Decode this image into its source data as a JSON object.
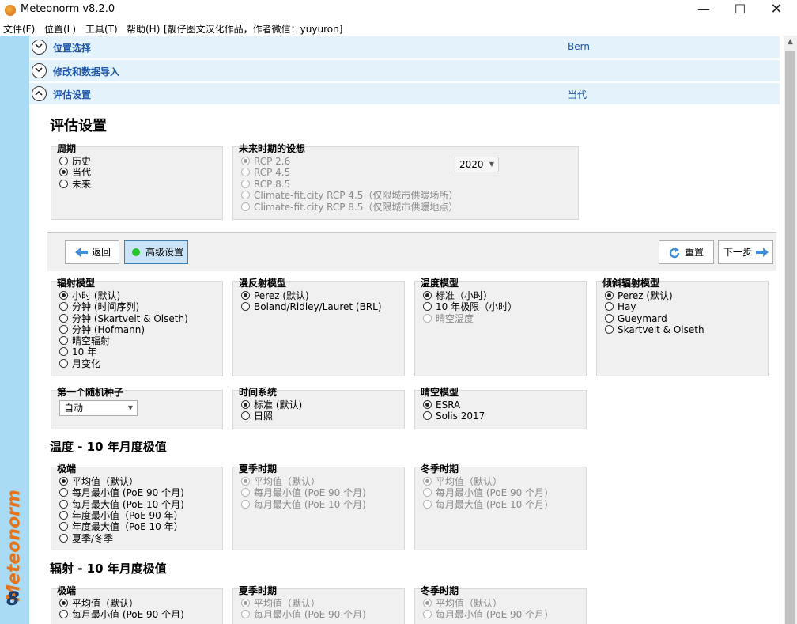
{
  "window": {
    "title": "Meteonorm v8.2.0",
    "min": "—",
    "max": "☐",
    "close": "✕"
  },
  "menu": [
    "文件(F)",
    "位置(L)",
    "工具(T)",
    "帮助(H)",
    "[靓仔图文汉化作品，作者微信：yuyuron]"
  ],
  "sidebar": {
    "brand": "Meteonorm",
    "version": "8"
  },
  "sections": [
    {
      "title": "位置选择",
      "value": "Bern"
    },
    {
      "title": "修改和数据导入",
      "value": ""
    },
    {
      "title": "评估设置",
      "value": "当代"
    }
  ],
  "page_title": "评估设置",
  "period": {
    "title": "周期",
    "options": [
      "历史",
      "当代",
      "未来"
    ],
    "selected": "当代"
  },
  "future": {
    "title": "未来时期的设想",
    "options": [
      "RCP 2.6",
      "RCP 4.5",
      "RCP 8.5",
      "Climate-fit.city RCP 4.5（仅限城市供暖场所）",
      "Climate-fit.city RCP 8.5（仅限城市供暖地点）"
    ],
    "selected": "RCP 2.6",
    "year": "2020"
  },
  "toolbar": {
    "back": "返回",
    "advanced": "高级设置",
    "reset": "重置",
    "next": "下一步"
  },
  "radiation_model": {
    "title": "辐射模型",
    "options": [
      "小时 (默认)",
      "分钟 (时间序列)",
      "分钟 (Skartveit & Olseth)",
      "分钟 (Hofmann)",
      "晴空辐射",
      "10 年",
      "月变化"
    ],
    "selected": "小时 (默认)"
  },
  "diffuse_model": {
    "title": "漫反射模型",
    "options": [
      "Perez (默认)",
      "Boland/Ridley/Lauret (BRL)"
    ],
    "selected": "Perez (默认)"
  },
  "temperature_model": {
    "title": "温度模型",
    "options": [
      "标准（小时）",
      "10 年极限（小时）",
      "晴空温度"
    ],
    "selected": "标准（小时）"
  },
  "tilt_model": {
    "title": "倾斜辐射模型",
    "options": [
      "Perez (默认)",
      "Hay",
      "Gueymard",
      "Skartveit & Olseth"
    ],
    "selected": "Perez (默认)"
  },
  "seed": {
    "title": "第一个随机种子",
    "value": "自动"
  },
  "time_system": {
    "title": "时间系统",
    "options": [
      "标准 (默认)",
      "日照"
    ],
    "selected": "标准 (默认)"
  },
  "clearsky": {
    "title": "晴空模型",
    "options": [
      "ESRA",
      "Solis 2017"
    ],
    "selected": "ESRA"
  },
  "temp_extremes": {
    "heading": "温度 - 10 年月度极值",
    "extreme": {
      "title": "极端",
      "options": [
        "平均值（默认）",
        "每月最小值 (PoE 90 个月)",
        "每月最大值 (PoE 10 个月)",
        "年度最小值（PoE 90 年）",
        "年度最大值（PoE 10 年）",
        "夏季/冬季"
      ],
      "selected": "平均值（默认）"
    },
    "summer": {
      "title": "夏季时期",
      "options": [
        "平均值（默认）",
        "每月最小值 (PoE 90 个月)",
        "每月最大值 (PoE 10 个月)"
      ],
      "selected": "平均值（默认）"
    },
    "winter": {
      "title": "冬季时期",
      "options": [
        "平均值（默认）",
        "每月最小值 (PoE 90 个月)",
        "每月最大值 (PoE 10 个月)"
      ],
      "selected": "平均值（默认）"
    }
  },
  "rad_extremes": {
    "heading": "辐射 - 10 年月度极值",
    "extreme": {
      "title": "极端",
      "options": [
        "平均值（默认）",
        "每月最小值 (PoE 90 个月)"
      ],
      "selected": "平均值（默认）"
    },
    "summer": {
      "title": "夏季时期",
      "options": [
        "平均值（默认）",
        "每月最小值 (PoE 90 个月)"
      ],
      "selected": "平均值（默认）"
    },
    "winter": {
      "title": "冬季时期",
      "options": [
        "平均值（默认）",
        "每月最小值 (PoE 90 个月)"
      ],
      "selected": "平均值（默认）"
    }
  },
  "colors": {
    "sidebar": "#a9dcf4",
    "section_bg": "#e3f2fb",
    "link": "#1d55a8",
    "brand": "#e5741b",
    "accent_green": "#27c42b"
  }
}
